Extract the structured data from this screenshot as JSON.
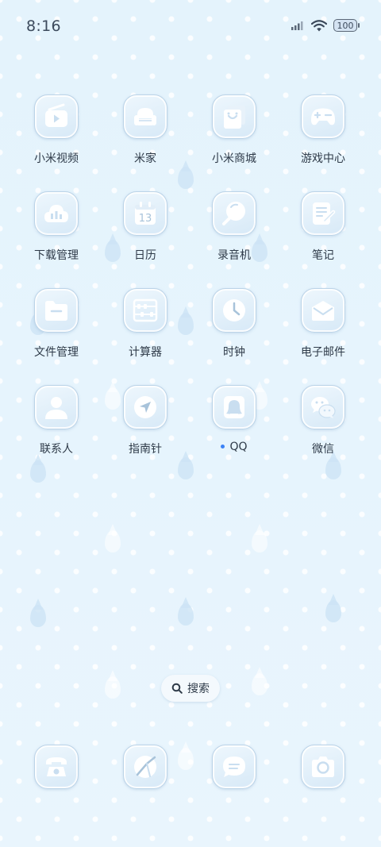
{
  "status_bar": {
    "time": "8:16",
    "battery": "100",
    "icons": [
      "signal-icon",
      "wifi-icon",
      "battery-icon"
    ]
  },
  "apps": [
    {
      "label": "小米视频",
      "icon": "video-icon"
    },
    {
      "label": "米家",
      "icon": "home-sofa-icon"
    },
    {
      "label": "小米商城",
      "icon": "shop-bag-icon"
    },
    {
      "label": "游戏中心",
      "icon": "gamepad-icon"
    },
    {
      "label": "下载管理",
      "icon": "cloud-download-icon"
    },
    {
      "label": "日历",
      "icon": "calendar-icon",
      "day": "13"
    },
    {
      "label": "录音机",
      "icon": "recorder-icon"
    },
    {
      "label": "笔记",
      "icon": "notes-icon"
    },
    {
      "label": "文件管理",
      "icon": "folder-icon"
    },
    {
      "label": "计算器",
      "icon": "abacus-icon"
    },
    {
      "label": "时钟",
      "icon": "clock-icon"
    },
    {
      "label": "电子邮件",
      "icon": "mail-icon"
    },
    {
      "label": "联系人",
      "icon": "contact-icon"
    },
    {
      "label": "指南针",
      "icon": "compass-icon"
    },
    {
      "label": "QQ",
      "icon": "qq-icon",
      "new_dot": true
    },
    {
      "label": "微信",
      "icon": "wechat-icon"
    }
  ],
  "search": {
    "label": "搜索",
    "icon": "search-icon"
  },
  "dock": [
    {
      "icon": "phone-icon"
    },
    {
      "icon": "browser-icon"
    },
    {
      "icon": "messages-icon"
    },
    {
      "icon": "camera-icon"
    }
  ],
  "colors": {
    "background": "#e4f3fc",
    "icon_glyph": "#ffffff",
    "icon_tile": "#d7e9f7",
    "dot": "#3b82f6",
    "text": "#2e3a48"
  }
}
